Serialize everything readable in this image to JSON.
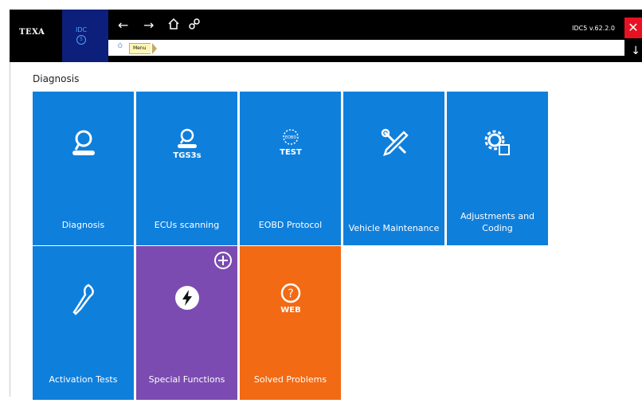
{
  "app": {
    "logo": "TEXA",
    "product": "IDC",
    "product_badge": "5",
    "version": "IDC5 v.62.2.0"
  },
  "nav": {
    "back_icon": "arrow-left-icon",
    "forward_icon": "arrow-right-icon",
    "home_icon": "home-icon",
    "link_icon": "link-icon",
    "close_icon": "close-icon",
    "down_icon": "arrow-down-icon"
  },
  "breadcrumb": {
    "home_icon": "home-icon",
    "items": [
      "Menu"
    ]
  },
  "section": {
    "title": "Diagnosis"
  },
  "colors": {
    "blue": "#0f7fdc",
    "purple": "#7b4bb1",
    "orange": "#f26a14",
    "close": "#e81123",
    "idc_blue": "#0c1f7a"
  },
  "tiles": [
    {
      "label": "Diagnosis",
      "icon": "magnifier-car-icon",
      "color": "blue"
    },
    {
      "label": "ECUs scanning",
      "icon": "tgs3s-scanner-icon",
      "icon_text": "TGS3s",
      "color": "blue"
    },
    {
      "label": "EOBD Protocol",
      "icon": "eobd-test-icon",
      "icon_text": "TEST",
      "icon_subtext": "EOBD",
      "color": "blue"
    },
    {
      "label": "Vehicle Maintenance",
      "icon": "wrench-screwdriver-icon",
      "color": "blue"
    },
    {
      "label": "Adjustments and Coding",
      "icon": "gear-chip-icon",
      "color": "blue"
    },
    {
      "label": "Activation Tests",
      "icon": "activation-probe-icon",
      "color": "blue"
    },
    {
      "label": "Special Functions",
      "icon": "lightning-icon",
      "color": "purple",
      "badge_icon": "plus-circle-icon"
    },
    {
      "label": "Solved Problems",
      "icon": "question-web-icon",
      "icon_text": "WEB",
      "color": "orange"
    }
  ]
}
